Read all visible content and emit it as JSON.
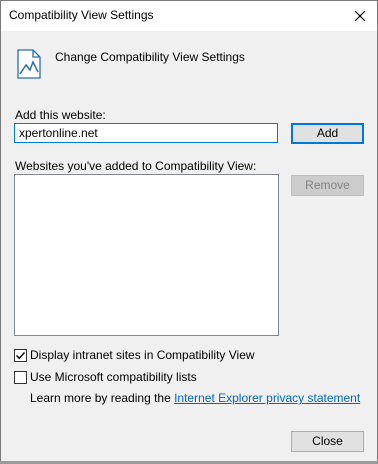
{
  "window": {
    "title": "Compatibility View Settings",
    "close_glyph": "✕"
  },
  "header": {
    "icon": "compatibility-page-icon",
    "title": "Change Compatibility View Settings"
  },
  "add_section": {
    "label": "Add this website:",
    "input_value": "xpertonline.net",
    "add_button": "Add"
  },
  "list_section": {
    "label": "Websites you've added to Compatibility View:",
    "items": [],
    "remove_button": "Remove"
  },
  "options": {
    "intranet": {
      "label": "Display intranet sites in Compatibility View",
      "checked": true
    },
    "microsoft_lists": {
      "label": "Use Microsoft compatibility lists",
      "checked": false
    }
  },
  "learn_more": {
    "prefix": "Learn more by reading the ",
    "link_text": "Internet Explorer privacy statement"
  },
  "footer": {
    "close_button": "Close"
  },
  "colors": {
    "accent": "#0078d7",
    "link": "#0066cc",
    "dialog_bg": "#f0f0f0"
  }
}
